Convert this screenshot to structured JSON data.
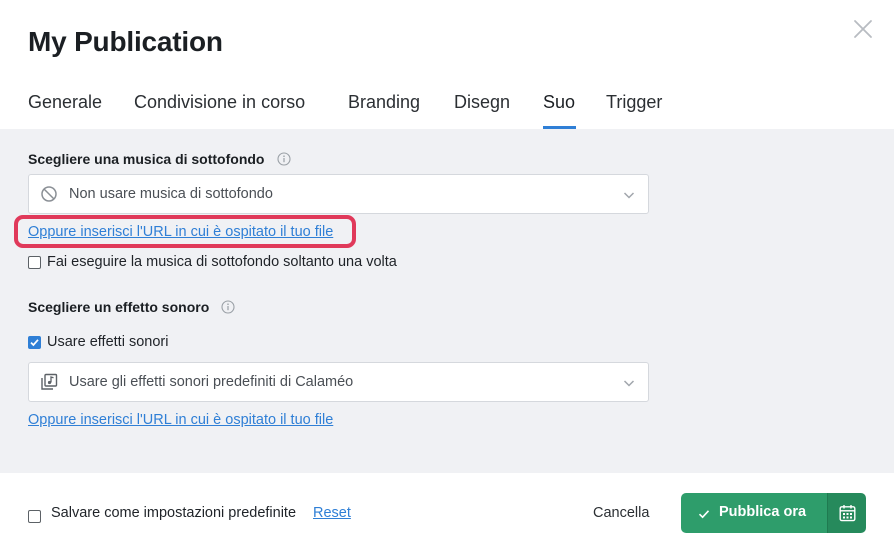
{
  "dialog": {
    "title": "My Publication"
  },
  "tabs": [
    {
      "label": "Generale"
    },
    {
      "label": "Condivisione in corso"
    },
    {
      "label": "Branding"
    },
    {
      "label": "Disegn"
    },
    {
      "label": "Suo"
    },
    {
      "label": "Trigger"
    }
  ],
  "active_tab": "Suo",
  "music": {
    "section_title": "Scegliere una musica di sottofondo",
    "select_value": "Non usare musica di sottofondo",
    "url_link": "Oppure inserisci l'URL in cui è ospitato il tuo file",
    "play_once_label": "Fai eseguire la musica di sottofondo soltanto una volta",
    "play_once_checked": false
  },
  "effects": {
    "section_title": "Scegliere un effetto sonoro",
    "use_effects_label": "Usare effetti sonori",
    "use_effects_checked": true,
    "select_value": "Usare gli effetti sonori predefiniti di Calaméo",
    "url_link": "Oppure inserisci l'URL in cui è ospitato il tuo file"
  },
  "footer": {
    "save_default_label": "Salvare come impostazioni predefinite",
    "save_default_checked": false,
    "reset_label": "Reset",
    "cancel_label": "Cancella",
    "publish_label": "Pubblica ora"
  },
  "colors": {
    "accent": "#2f7fd6",
    "highlight": "#e0395a",
    "publish": "#2e9d6b",
    "panel_bg": "#f0f1f4"
  },
  "icons": {
    "close": "close-icon",
    "info": "info-icon",
    "no_music": "prohibited-icon",
    "sound_library": "music-library-icon",
    "chevron": "chevron-down-icon",
    "publish_check": "check-icon",
    "schedule": "calendar-icon"
  }
}
